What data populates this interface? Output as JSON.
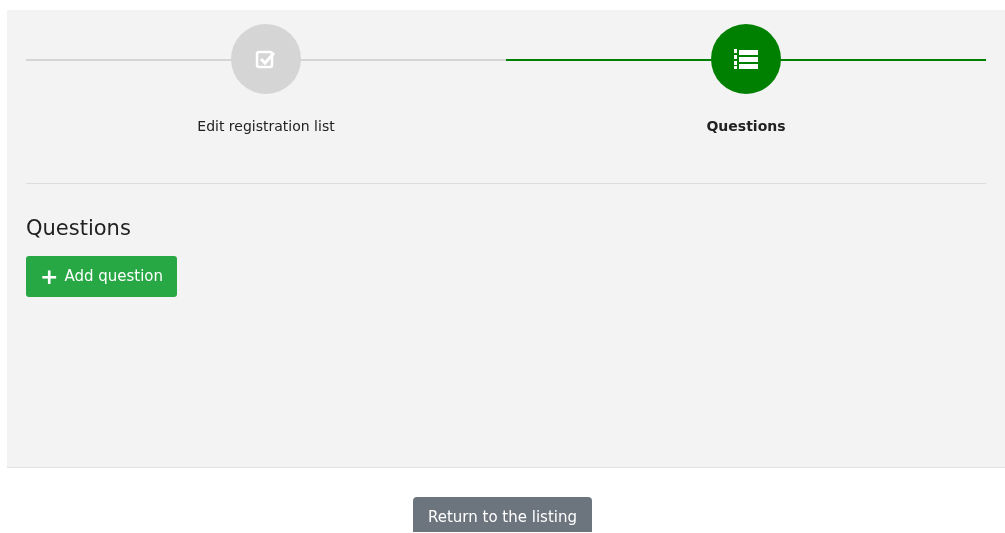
{
  "steps": [
    {
      "label": "Edit registration list",
      "kind": "checkbox",
      "selected": false
    },
    {
      "label": "Questions",
      "kind": "list",
      "selected": true
    }
  ],
  "section": {
    "title": "Questions",
    "add_button": {
      "icon": "+",
      "label": "Add question"
    }
  },
  "footer": {
    "return_button": "Return to the listing"
  }
}
